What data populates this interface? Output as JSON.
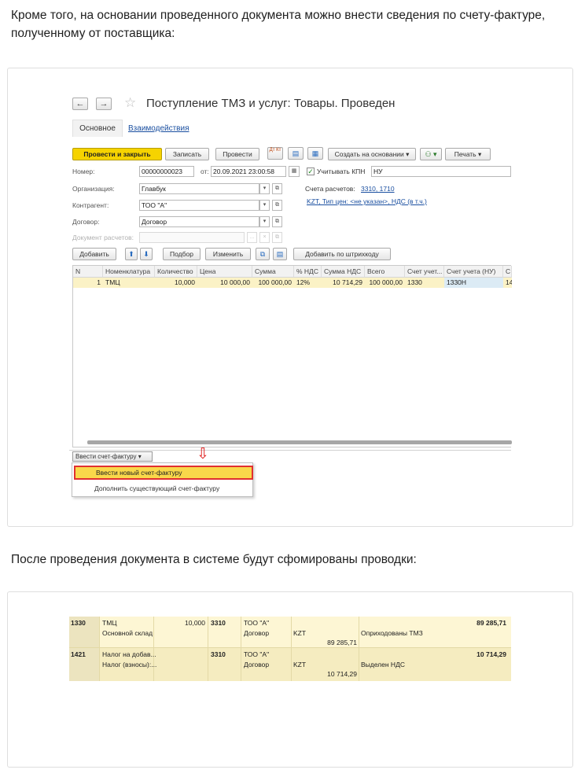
{
  "text": {
    "para1": "Кроме того, на основании проведенного документа можно внести сведения по счету-фактуре, полученному от поставщика:",
    "para2": "После проведения документа в системе будут сфомированы проводки:"
  },
  "document": {
    "title": "Поступление ТМЗ и услуг: Товары. Проведен",
    "nav_back": "←",
    "nav_forward": "→",
    "star": "☆",
    "tabs": [
      "Основное",
      "Взаимодействия"
    ],
    "toolbar": {
      "post_close": "Провести и закрыть",
      "save": "Записать",
      "post": "Провести",
      "dt_kt_icon": "Дт Кт",
      "report_icon": "▤",
      "print_icon": "▦",
      "create_based": "Создать на основании ▾",
      "related_icon": "⚇ ▾",
      "print": "Печать ▾"
    },
    "form": {
      "number_label": "Номер:",
      "number_value": "00000000023",
      "date_label": "от:",
      "date_value": "20.09.2021 23:00:58",
      "calendar_icon": "▦",
      "kpn_check": "✓",
      "kpn_label": "Учитывать КПН",
      "kpn_value": "НУ",
      "org_label": "Организация:",
      "org_value": "Главбук",
      "accounts_label": "Счета расчетов:",
      "accounts_value": "3310, 1710",
      "contractor_label": "Контрагент:",
      "contractor_value": "ТОО \"А\"",
      "price_link": "KZT, Тип цен: <не указан>, НДС (в т.ч.)",
      "contract_label": "Договор:",
      "contract_value": "Договор",
      "settlement_label": "Документ расчетов:",
      "settlement_value": "",
      "dropdown_glyph": "▾",
      "open_glyph": "⧉",
      "clear_glyph": "×",
      "select_glyph": "..."
    },
    "table_toolbar": {
      "add": "Добавить",
      "up": "⬆",
      "down": "⬇",
      "pick": "Подбор",
      "change": "Изменить",
      "copy_icon": "⧉",
      "paste_icon": "▤",
      "barcode": "Добавить по штрихкоду"
    },
    "columns": [
      "N",
      "Номенклатура",
      "Количество",
      "Цена",
      "Сумма",
      "% НДС",
      "Сумма НДС",
      "Всего",
      "Счет учет...",
      "Счет учета (НУ)",
      "С"
    ],
    "rows": [
      [
        "1",
        "ТМЦ",
        "10,000",
        "10 000,00",
        "100 000,00",
        "12%",
        "10 714,29",
        "100 000,00",
        "1330",
        "1330Н",
        "14"
      ]
    ],
    "invoice_dropdown": "Ввести счет-фактуру ▾",
    "invoice_menu": [
      "Ввести новый счет-фактуру",
      "Дополнить существующий счет-фактуру"
    ],
    "arrow_mark": "⇩"
  },
  "ledger": {
    "rows": [
      {
        "account": "1330",
        "item": "ТМЦ",
        "item_sub": "Основной склад",
        "qty": "10,000",
        "corr_account": "3310",
        "contractor": "ТОО \"А\"",
        "contract": "Договор",
        "currency": "KZT",
        "currency_amount": "89 285,71",
        "content": "Оприходованы ТМЗ",
        "amount": "89 285,71"
      },
      {
        "account": "1421",
        "item": "Налог на добав...",
        "item_sub": "Налог (взносы):...",
        "qty": "",
        "corr_account": "3310",
        "contractor": "ТОО \"А\"",
        "contract": "Договор",
        "currency": "KZT",
        "currency_amount": "10 714,29",
        "content": "Выделен НДС",
        "amount": "10 714,29"
      }
    ],
    "colors": {
      "row1_bg": "#fdf6d4",
      "row2_bg": "#f5ecc0",
      "account_bg": "#ece4bf"
    }
  },
  "colors": {
    "accent_yellow": "#f6d300",
    "link_blue": "#1a4fa0",
    "highlight_red": "#e02020",
    "selected_row": "#fbf2c6"
  }
}
